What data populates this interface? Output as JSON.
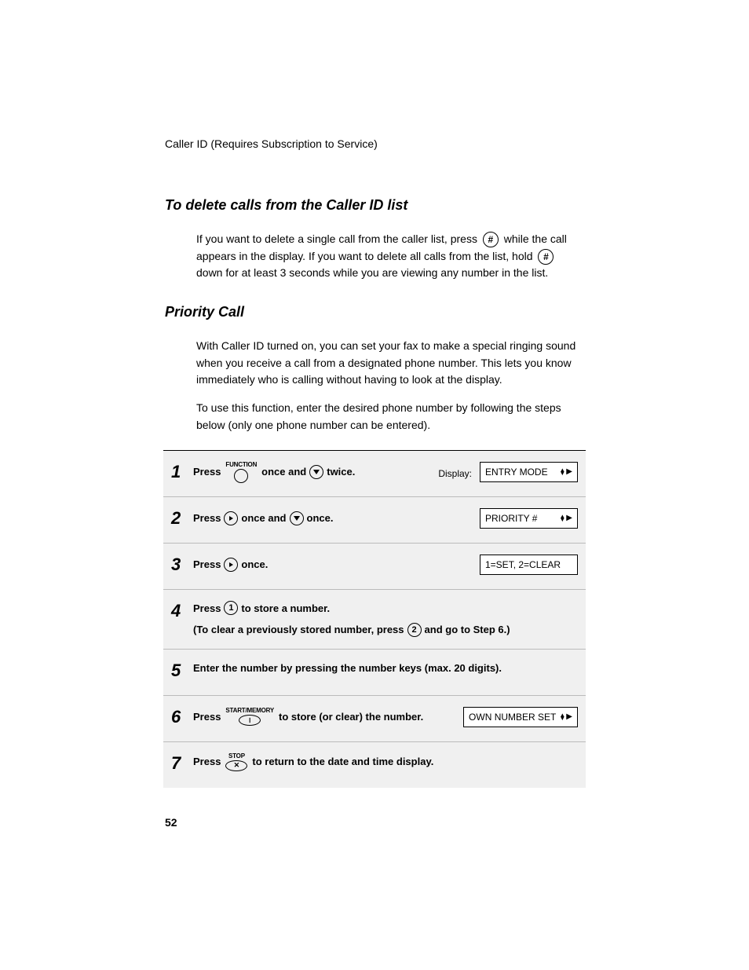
{
  "header": "Caller ID (Requires Subscription to Service)",
  "section1": {
    "title": "To delete calls from the Caller ID list",
    "p1a": "If you want to delete a single call from the caller list, press ",
    "p1b": " while the call appears in the display. If you want to delete all calls from the list, hold ",
    "p1c": " down for at least 3 seconds while you are viewing any number in the list."
  },
  "section2": {
    "title": "Priority Call",
    "p1": "With Caller ID turned on, you can set your fax to make a special ringing sound when you receive a call from a designated phone number. This lets you know immediately who is calling without having to look at the display.",
    "p2": "To use this function, enter the desired phone number by following the steps below (only one phone number can be entered)."
  },
  "steps": {
    "s1": {
      "press": "Press",
      "func": "FUNCTION",
      "mid": "once and",
      "end": "twice.",
      "display_label": "Display:",
      "lcd": "ENTRY MODE"
    },
    "s2": {
      "press": "Press",
      "mid": "once and",
      "end": "once.",
      "lcd": "PRIORITY #"
    },
    "s3": {
      "press": "Press",
      "end": "once.",
      "lcd": "1=SET, 2=CLEAR"
    },
    "s4": {
      "press": "Press",
      "mid": "to store a number.",
      "sub_a": "(To clear a previously stored number, press ",
      "sub_b": " and go to Step 6.)",
      "one": "1",
      "two": "2"
    },
    "s5": {
      "text": "Enter the number by pressing the number keys (max. 20 digits)."
    },
    "s6": {
      "press": "Press",
      "func": "START/MEMORY",
      "mid": "to store (or clear) the number.",
      "lcd": "OWN NUMBER SET"
    },
    "s7": {
      "press": "Press",
      "func": "STOP",
      "mid": "to return to the date and time display."
    }
  },
  "icons": {
    "hash": "#",
    "stop": "◇",
    "power": "①"
  },
  "page_number": "52"
}
